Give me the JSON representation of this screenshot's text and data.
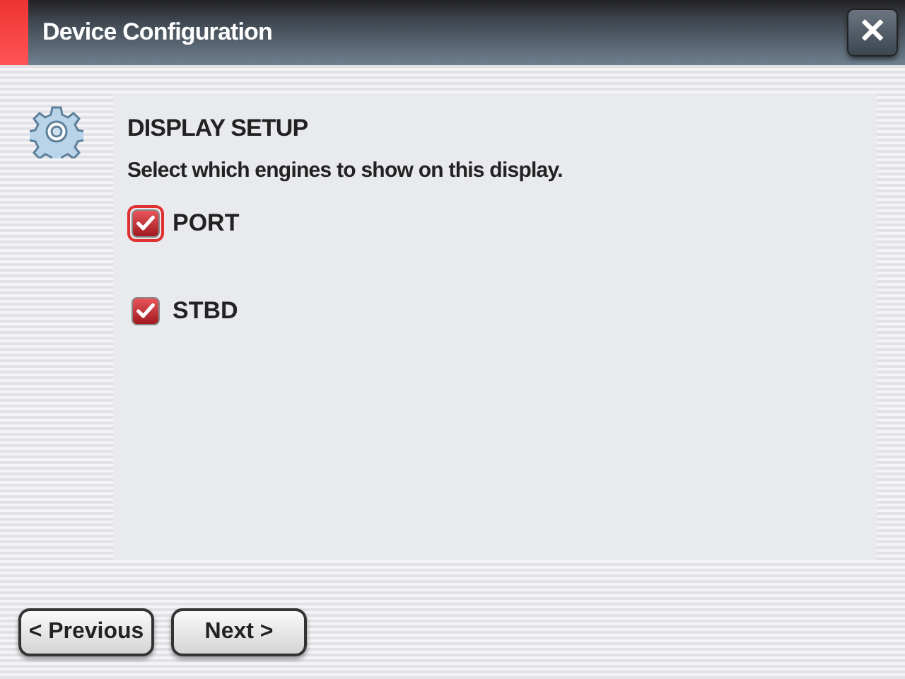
{
  "window": {
    "title": "Device Configuration",
    "close_label": "✕"
  },
  "section": {
    "title": "DISPLAY SETUP",
    "instruction": "Select which engines to show on this display."
  },
  "options": [
    {
      "label": "PORT",
      "checked": true,
      "focused": true
    },
    {
      "label": "STBD",
      "checked": true,
      "focused": false
    }
  ],
  "buttons": [
    {
      "label": "< Previous"
    },
    {
      "label": "Next >"
    }
  ]
}
